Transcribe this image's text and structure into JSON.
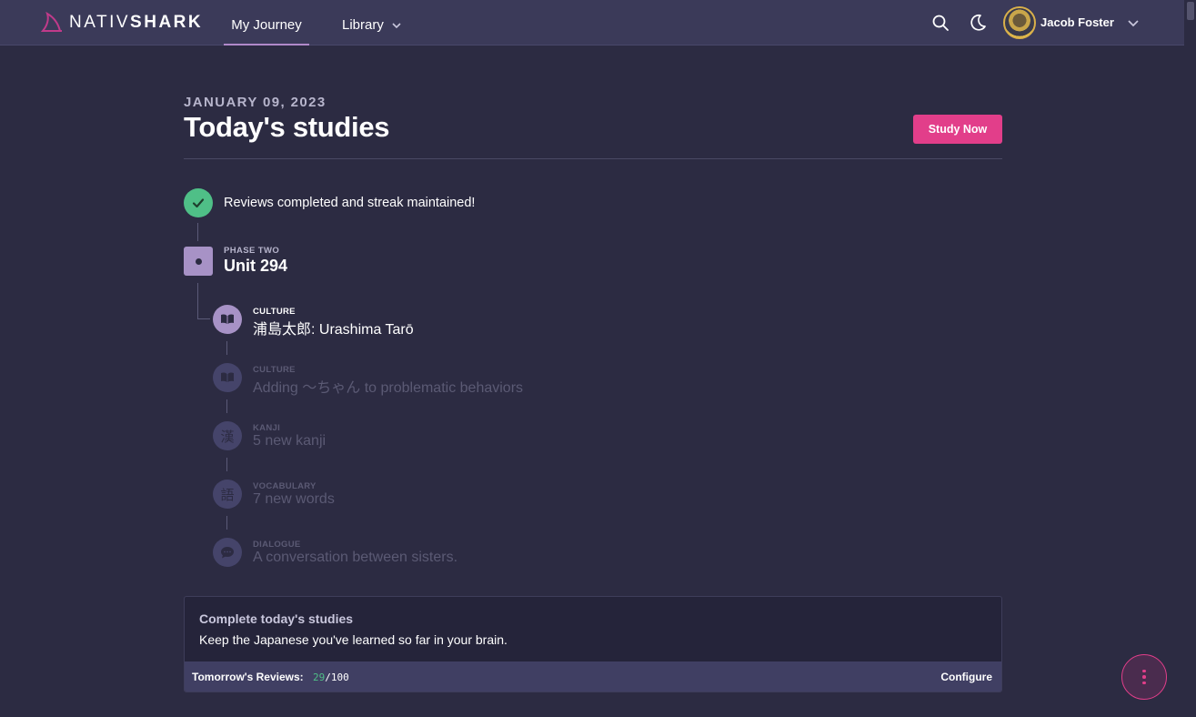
{
  "nav": {
    "logo_text_a": "NATIV",
    "logo_text_b": "SHARK",
    "tabs": [
      {
        "label": "My Journey",
        "active": true
      },
      {
        "label": "Library",
        "active": false
      }
    ],
    "user_name": "Jacob Foster"
  },
  "header": {
    "date": "JANUARY 09, 2023",
    "title": "Today's studies",
    "study_button": "Study Now"
  },
  "timeline": {
    "streak_message": "Reviews completed and streak maintained!",
    "phase": "PHASE TWO",
    "unit": "Unit 294",
    "lessons": [
      {
        "category": "CULTURE",
        "name": "浦島太郎: Urashima Tarō",
        "icon": "book-icon",
        "active": true
      },
      {
        "category": "CULTURE",
        "name": "Adding 〜ちゃん to problematic behaviors",
        "icon": "book-icon",
        "active": false
      },
      {
        "category": "KANJI",
        "name": "5 new kanji",
        "icon": "kanji-icon",
        "glyph": "漢",
        "active": false
      },
      {
        "category": "VOCABULARY",
        "name": "7 new words",
        "icon": "vocabulary-icon",
        "glyph": "語",
        "active": false
      },
      {
        "category": "DIALOGUE",
        "name": "A conversation between sisters.",
        "icon": "speech-bubble-icon",
        "active": false
      }
    ]
  },
  "card": {
    "title": "Complete today's studies",
    "description": "Keep the Japanese you've learned so far in your brain.",
    "reviews_label": "Tomorrow's Reviews:",
    "reviews_done": "29",
    "reviews_total": "/100",
    "configure": "Configure"
  },
  "colors": {
    "accent": "#e23e8a",
    "success": "#4fbf87",
    "lesson_active": "#a792c6",
    "background": "#2c2b42",
    "topbar": "#3b3a59"
  }
}
